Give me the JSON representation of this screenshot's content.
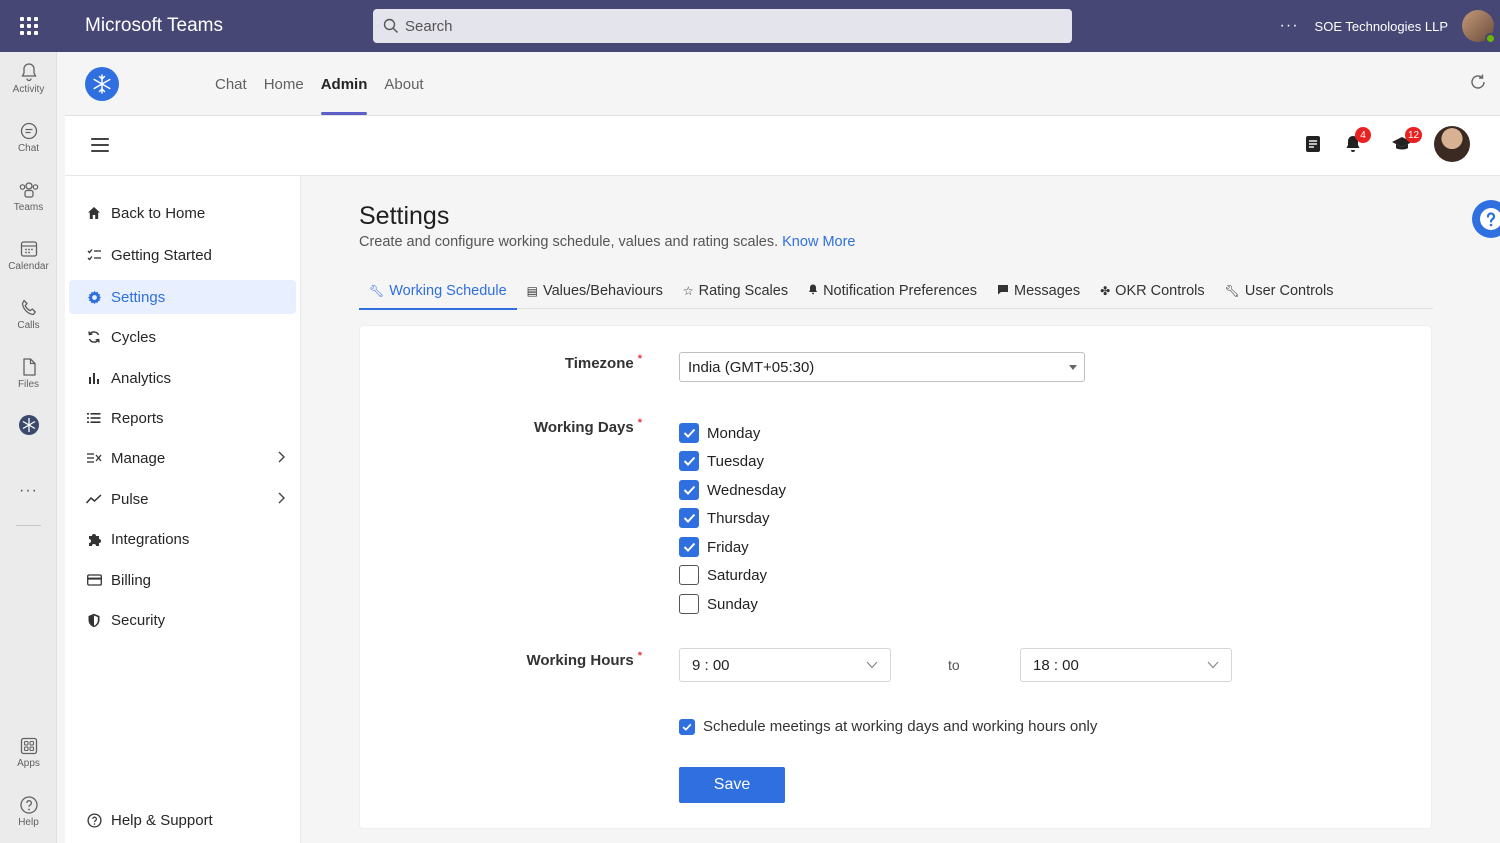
{
  "teams": {
    "app_name": "Microsoft Teams",
    "search_placeholder": "Search",
    "more": "···",
    "org_name": "SOE Technologies LLP"
  },
  "rail": {
    "items": [
      {
        "label": "Activity",
        "icon": "bell-icon"
      },
      {
        "label": "Chat",
        "icon": "chat-icon"
      },
      {
        "label": "Teams",
        "icon": "teams-icon"
      },
      {
        "label": "Calendar",
        "icon": "calendar-icon"
      },
      {
        "label": "Calls",
        "icon": "phone-icon"
      },
      {
        "label": "Files",
        "icon": "file-icon"
      },
      {
        "label": "Apps",
        "icon": "apps-icon"
      },
      {
        "label": "Help",
        "icon": "help-icon"
      }
    ],
    "more": "···"
  },
  "app_tabs": [
    "Chat",
    "Home",
    "Admin",
    "About"
  ],
  "app_tabs_active": "Admin",
  "toolbar": {
    "notifications_count": "4",
    "learning_count": "12"
  },
  "sidebar": {
    "items": [
      {
        "label": "Back to Home",
        "icon": "home-icon"
      },
      {
        "label": "Getting Started",
        "icon": "checklist-icon"
      },
      {
        "label": "Settings",
        "icon": "gear-icon"
      },
      {
        "label": "Cycles",
        "icon": "cycle-icon"
      },
      {
        "label": "Analytics",
        "icon": "bar-chart-icon"
      },
      {
        "label": "Reports",
        "icon": "list-icon"
      },
      {
        "label": "Manage",
        "icon": "manage-icon"
      },
      {
        "label": "Pulse",
        "icon": "pulse-icon"
      },
      {
        "label": "Integrations",
        "icon": "puzzle-icon"
      },
      {
        "label": "Billing",
        "icon": "credit-card-icon"
      },
      {
        "label": "Security",
        "icon": "shield-icon"
      }
    ],
    "active": "Settings",
    "help": "Help & Support"
  },
  "page": {
    "title": "Settings",
    "subtitle": "Create and configure working schedule, values and rating scales.",
    "know_more": "Know More"
  },
  "settings_tabs": [
    {
      "label": "Working Schedule",
      "icon": "wrench-icon"
    },
    {
      "label": "Values/Behaviours",
      "icon": "values-icon"
    },
    {
      "label": "Rating Scales",
      "icon": "star-icon"
    },
    {
      "label": "Notification Preferences",
      "icon": "bell-icon"
    },
    {
      "label": "Messages",
      "icon": "message-icon"
    },
    {
      "label": "OKR Controls",
      "icon": "okr-icon"
    },
    {
      "label": "User Controls",
      "icon": "wrench-icon"
    }
  ],
  "settings_tabs_active": "Working Schedule",
  "form": {
    "timezone_label": "Timezone",
    "timezone_value": "India (GMT+05:30)",
    "working_days_label": "Working Days",
    "days": [
      {
        "label": "Monday",
        "checked": true
      },
      {
        "label": "Tuesday",
        "checked": true
      },
      {
        "label": "Wednesday",
        "checked": true
      },
      {
        "label": "Thursday",
        "checked": true
      },
      {
        "label": "Friday",
        "checked": true
      },
      {
        "label": "Saturday",
        "checked": false
      },
      {
        "label": "Sunday",
        "checked": false
      }
    ],
    "working_hours_label": "Working Hours",
    "start_time": "9 : 00",
    "to_label": "to",
    "end_time": "18 : 00",
    "schedule_meetings_label": "Schedule meetings at working days and working hours only",
    "schedule_meetings_checked": true,
    "save_label": "Save",
    "required_mark": "*"
  },
  "colors": {
    "teams_header": "#464775",
    "accent": "#2f6fe0",
    "badge": "#e82121"
  }
}
